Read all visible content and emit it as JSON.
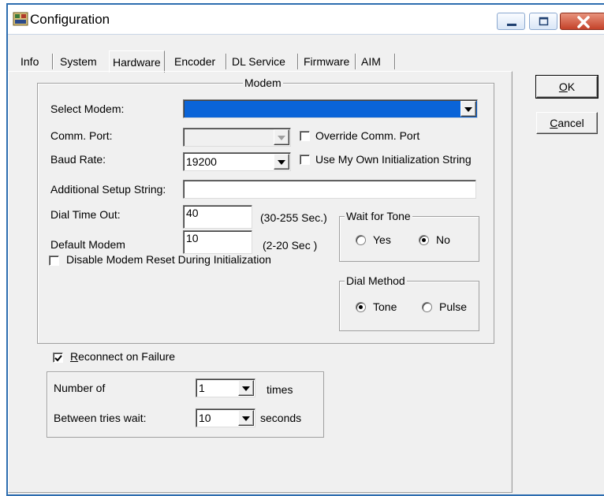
{
  "window": {
    "title": "Configuration",
    "colors": {
      "accent": "#2d6db0",
      "selection": "#0a64d8",
      "close_button": "#c4422a",
      "dialog_bg": "#f0f0f0"
    }
  },
  "tabs": [
    "Info",
    "System",
    "Hardware",
    "Encoder",
    "DL Service",
    "Firmware",
    "AIM"
  ],
  "active_tab": "Hardware",
  "buttons": {
    "ok_accel": "O",
    "ok_rest": "K",
    "cancel_accel": "C",
    "cancel_rest": "ancel"
  },
  "modem": {
    "group_title": "Modem",
    "select_modem_label": "Select Modem:",
    "select_modem_value": "",
    "comm_port_label": "Comm. Port:",
    "comm_port_value": "",
    "override_comm_port_label": "Override Comm. Port",
    "baud_rate_label": "Baud Rate:",
    "baud_rate_value": "19200",
    "use_own_init_label": "Use My Own Initialization String",
    "additional_setup_label": "Additional Setup String:",
    "additional_setup_value": "",
    "dial_timeout_label": "Dial Time Out:",
    "dial_timeout_value": "40",
    "dial_timeout_hint": "(30-255 Sec.)",
    "default_modem_label": "Default Modem",
    "default_modem_value": "10",
    "default_modem_hint": "(2-20 Sec )",
    "disable_reset_label": "Disable Modem Reset During Initialization",
    "wait_for_tone": {
      "title": "Wait for Tone",
      "yes": "Yes",
      "no": "No",
      "selected": "No"
    },
    "dial_method": {
      "title": "Dial Method",
      "tone": "Tone",
      "pulse": "Pulse",
      "selected": "Tone"
    }
  },
  "reconnect": {
    "accel": "R",
    "label_rest": "econnect on Failure",
    "checked": true,
    "number_of_label": "Number of",
    "number_of_value": "1",
    "times_label": "times",
    "between_label": "Between tries wait:",
    "between_value": "10",
    "seconds_label": "seconds"
  },
  "icons": [
    "app-icon",
    "minimize-icon",
    "maximize-icon",
    "close-icon",
    "dropdown-arrow-icon",
    "checkmark-icon"
  ]
}
